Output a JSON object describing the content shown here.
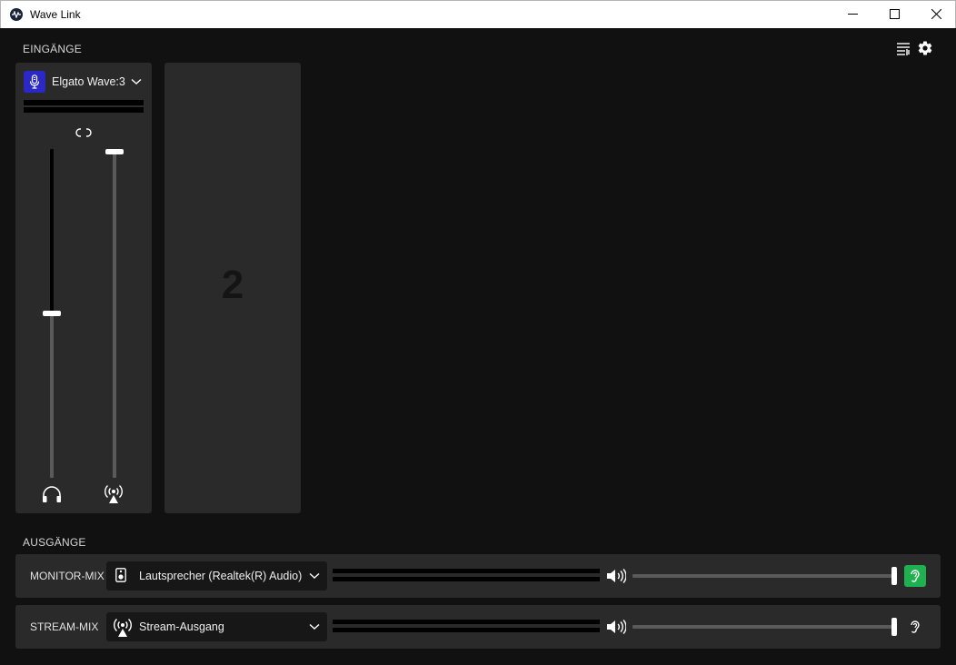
{
  "window": {
    "title": "Wave Link"
  },
  "colors": {
    "background": "#111111",
    "panel": "#2a2a2a",
    "mic_accent": "#2a28c6",
    "monitor_active": "#1fb14f"
  },
  "inputs": {
    "section_label": "EINGÄNGE",
    "toolbar_icons": [
      "mixer-settings-icon",
      "gear-icon"
    ],
    "channels": [
      {
        "name": "Elgato Wave:3",
        "icon": "microphone-icon",
        "link_icon": "link-icon",
        "monitor_level": 0.5,
        "stream_level": 1.0,
        "monitor_icon": "headphones-icon",
        "stream_icon": "broadcast-icon"
      }
    ],
    "empty_slot_number": "2"
  },
  "outputs": {
    "section_label": "AUSGÄNGE",
    "mixes": [
      {
        "label": "MONITOR-MIX",
        "device": "Lautsprecher (Realtek(R) Audio)",
        "device_icon": "speaker-icon",
        "volume_level": 1.0,
        "monitor_active": true
      },
      {
        "label": "STREAM-MIX",
        "device": "Stream-Ausgang",
        "device_icon": "broadcast-icon",
        "volume_level": 1.0,
        "monitor_active": false
      }
    ]
  }
}
